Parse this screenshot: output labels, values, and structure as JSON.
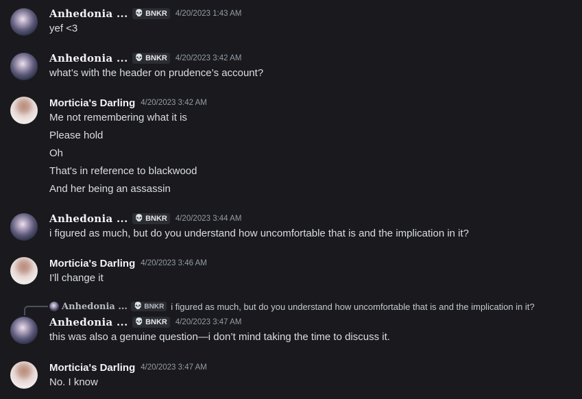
{
  "users": {
    "anhedonia": {
      "name": "Anhedonia ...",
      "tag": "BNKR"
    },
    "morticia": {
      "name": "Morticia's Darling"
    }
  },
  "messages": [
    {
      "author": "Anhedonia ...",
      "tag": "BNKR",
      "timestamp": "4/20/2023 1:43 AM",
      "lines": [
        "yef <3"
      ]
    },
    {
      "author": "Anhedonia ...",
      "tag": "BNKR",
      "timestamp": "4/20/2023 3:42 AM",
      "lines": [
        "what’s with the header on prudence’s account?"
      ]
    },
    {
      "author": "Morticia's Darling",
      "timestamp": "4/20/2023 3:42 AM",
      "lines": [
        "Me not remembering what it is",
        "Please hold",
        "Oh",
        "That's in reference to blackwood",
        "And her being an assassin"
      ]
    },
    {
      "author": "Anhedonia ...",
      "tag": "BNKR",
      "timestamp": "4/20/2023 3:44 AM",
      "lines": [
        "i figured as much, but do you understand how uncomfortable that is and the implication in it?"
      ]
    },
    {
      "author": "Morticia's Darling",
      "timestamp": "4/20/2023 3:46 AM",
      "lines": [
        "I'll change it"
      ]
    },
    {
      "author": "Anhedonia ...",
      "tag": "BNKR",
      "timestamp": "4/20/2023 3:47 AM",
      "lines": [
        "this was also a genuine question—i don’t mind taking the time to discuss it."
      ],
      "reply": {
        "author": "Anhedonia ...",
        "tag": "BNKR",
        "text": "i figured as much, but do you understand how uncomfortable that is and the implication in it?"
      }
    },
    {
      "author": "Morticia's Darling",
      "timestamp": "4/20/2023 3:47 AM",
      "lines": [
        "No. I know"
      ]
    }
  ],
  "icons": {
    "tag_icon": "skull-icon",
    "reply_icon": "reply-spine"
  },
  "colors": {
    "background": "#1a1a1e",
    "username": "#f2f3f5",
    "timestamp": "#949ba4",
    "text": "#dbdee1"
  }
}
